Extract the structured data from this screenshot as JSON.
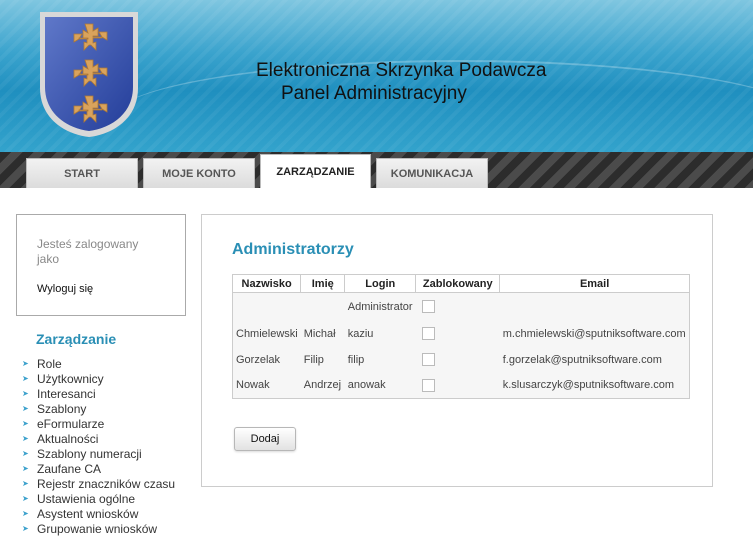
{
  "header": {
    "title_line1": "Elektroniczna Skrzynka Podawcza",
    "title_line2": "Panel Administracyjny",
    "logo_icon": "coat-of-arms-crosses-icon"
  },
  "nav": {
    "tabs": [
      {
        "label": "START",
        "active": false
      },
      {
        "label": "MOJE KONTO",
        "active": false
      },
      {
        "label": "ZARZĄDZANIE",
        "active": true
      },
      {
        "label": "KOMUNIKACJA",
        "active": false
      }
    ]
  },
  "login": {
    "status_text": "Jesteś zalogowany jako",
    "logout_label": "Wyloguj się"
  },
  "sidebar": {
    "title": "Zarządzanie",
    "items": [
      {
        "label": "Role"
      },
      {
        "label": "Użytkownicy"
      },
      {
        "label": "Interesanci"
      },
      {
        "label": "Szablony"
      },
      {
        "label": "eFormularze"
      },
      {
        "label": "Aktualności"
      },
      {
        "label": "Szablony numeracji"
      },
      {
        "label": "Zaufane CA"
      },
      {
        "label": "Rejestr znaczników czasu"
      },
      {
        "label": "Ustawienia ogólne"
      },
      {
        "label": "Asystent wniosków"
      },
      {
        "label": "Grupowanie wniosków"
      }
    ]
  },
  "main": {
    "title": "Administratorzy",
    "table": {
      "columns": [
        "Nazwisko",
        "Imię",
        "Login",
        "Zablokowany",
        "Email"
      ],
      "rows": [
        {
          "nazwisko": "",
          "imie": "",
          "login": "Administrator",
          "zablokowany": false,
          "email": ""
        },
        {
          "nazwisko": "Chmielewski",
          "imie": "Michał",
          "login": "kaziu",
          "zablokowany": false,
          "email": "m.chmielewski@sputniksoftware.com"
        },
        {
          "nazwisko": "Gorzelak",
          "imie": "Filip",
          "login": "filip",
          "zablokowany": false,
          "email": "f.gorzelak@sputniksoftware.com"
        },
        {
          "nazwisko": "Nowak",
          "imie": "Andrzej",
          "login": "anowak",
          "zablokowany": false,
          "email": "k.slusarczyk@sputniksoftware.com"
        }
      ]
    },
    "add_button_label": "Dodaj"
  },
  "colors": {
    "accent": "#2a8fb5",
    "header_blue": "#1f8fbf",
    "nav_dark": "#2c2c2c"
  }
}
